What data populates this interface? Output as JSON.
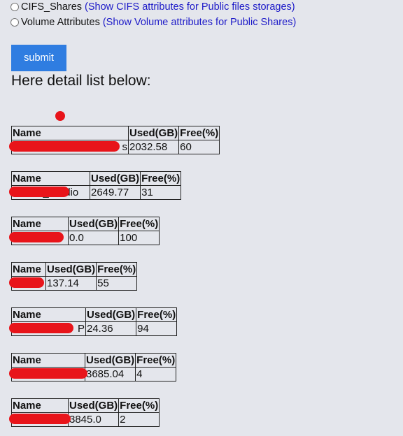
{
  "options": [
    {
      "name": "CIFS_Shares",
      "description": "(Show CIFS attributes for Public files storages)"
    },
    {
      "name": "Volume Attributes",
      "description": "(Show Volume attributes for Public Shares)"
    }
  ],
  "submit_label": "submit",
  "heading": "Here detail list below:",
  "table_headers": {
    "name": "Name",
    "used": "Used(GB)",
    "free": "Free(%)"
  },
  "tables": [
    {
      "name": "s",
      "used": "2032.58",
      "free": "60"
    },
    {
      "name": "Dance_Studio",
      "used": "2649.77",
      "free": "31"
    },
    {
      "name": "",
      "used": "0.0",
      "free": "100"
    },
    {
      "name": "",
      "used": "137.14",
      "free": "55"
    },
    {
      "name": "P",
      "used": "24.36",
      "free": "94"
    },
    {
      "name": "",
      "used": "3685.04",
      "free": "4"
    },
    {
      "name": "",
      "used": "3845.0",
      "free": "2"
    }
  ],
  "colors": {
    "background": "#e4e6ec",
    "link": "#1d1ac8",
    "button": "#2f7de1",
    "redaction": "#e8141a"
  }
}
